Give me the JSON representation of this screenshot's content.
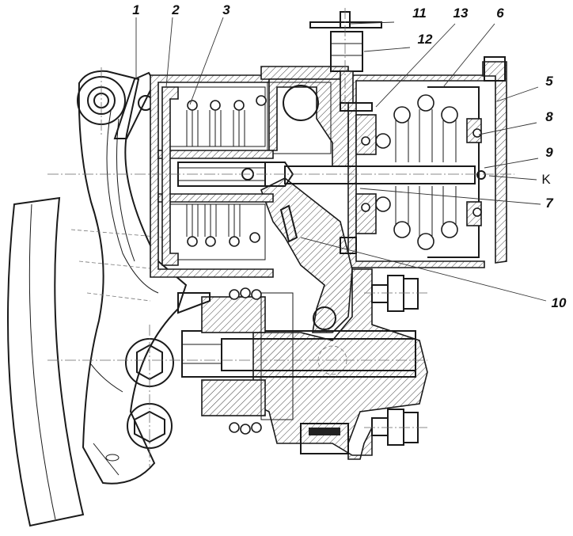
{
  "labels": {
    "l1": "1",
    "l2": "2",
    "l3": "3",
    "l11": "11",
    "l13": "13",
    "l6": "6",
    "l12": "12",
    "l5": "5",
    "l8": "8",
    "l9": "9",
    "lK": "K",
    "l7": "7",
    "l10": "10"
  }
}
